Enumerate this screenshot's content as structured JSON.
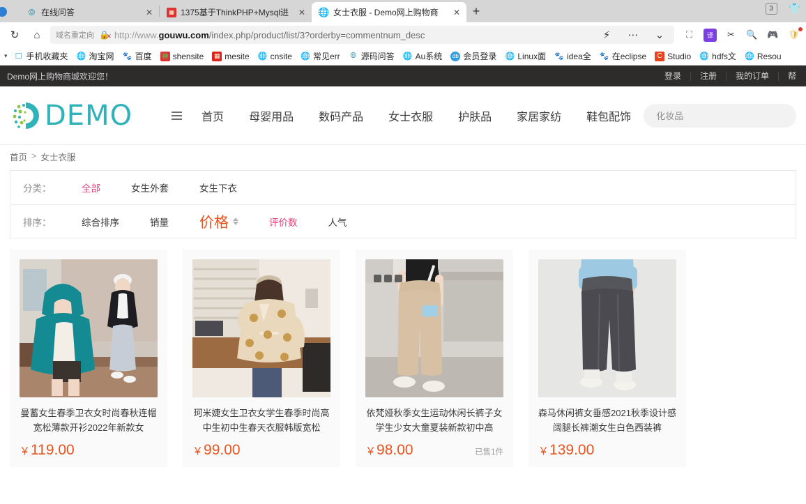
{
  "browser": {
    "tabs": [
      {
        "title": "在线问答",
        "favicon": "compass-icon",
        "active": false
      },
      {
        "title": "1375基于ThinkPHP+Mysql进",
        "favicon": "red-doc-icon",
        "active": false
      },
      {
        "title": "女士衣服 - Demo网上购物商",
        "favicon": "globe-icon",
        "active": true
      }
    ],
    "new_tab_label": "+",
    "tab_count": "3",
    "window_icon": "shirt-icon",
    "nav": {
      "reload_icon": "reload-icon",
      "home_icon": "home-icon",
      "redirect_tag": "域名重定向",
      "security_icon": "broken-lock-icon",
      "url_scheme": "http://www.",
      "url_domain": "gouwu.com",
      "url_path": "/index.php/product/list/3?orderby=commentnum_desc",
      "lightning_icon": "lightning-icon",
      "more_icon": "more-dots-icon",
      "chevron_icon": "chevron-down-icon",
      "extensions": [
        "pocket-icon",
        "translate-icon",
        "scissors-icon",
        "search-icon",
        "game-icon",
        "shield-icon"
      ]
    },
    "bookmarks": [
      {
        "label": "手机收藏夹",
        "icon": "mobile-icon"
      },
      {
        "label": "淘宝网",
        "icon": "globe-icon"
      },
      {
        "label": "百度",
        "icon": "baidu-icon"
      },
      {
        "label": "shensite",
        "icon": "shen-icon"
      },
      {
        "label": "mesite",
        "icon": "red-icon"
      },
      {
        "label": "cnsite",
        "icon": "globe-icon"
      },
      {
        "label": "常见err",
        "icon": "globe-icon"
      },
      {
        "label": "源码问答",
        "icon": "compass-icon"
      },
      {
        "label": "Au系统",
        "icon": "globe-icon"
      },
      {
        "label": "会员登录",
        "icon": "db-icon"
      },
      {
        "label": "Linux面",
        "icon": "globe-icon"
      },
      {
        "label": "idea全",
        "icon": "baidu-icon"
      },
      {
        "label": "在eclipse",
        "icon": "baidu-icon"
      },
      {
        "label": "Studio",
        "icon": "c-icon"
      },
      {
        "label": "hdfs文",
        "icon": "globe-icon"
      },
      {
        "label": "Resou",
        "icon": "globe-icon"
      }
    ]
  },
  "site": {
    "topbar": {
      "welcome": "Demo网上购物商城欢迎您！",
      "links": [
        "登录",
        "注册",
        "我的订单",
        "帮"
      ]
    },
    "header": {
      "logo_text": "DEMO",
      "logo_icon": "demo-circle-logo",
      "menu_icon": "hamburger-icon",
      "nav": [
        "首页",
        "母婴用品",
        "数码产品",
        "女士衣服",
        "护肤品",
        "家居家纺",
        "鞋包配饰"
      ],
      "search_placeholder": "化妆品"
    },
    "breadcrumb": {
      "home": "首页",
      "separator": ">",
      "current": "女士衣服"
    },
    "filters": {
      "category_label": "分类：",
      "categories": [
        {
          "label": "全部",
          "active": true
        },
        {
          "label": "女生外套",
          "active": false
        },
        {
          "label": "女生下衣",
          "active": false
        }
      ],
      "sort_label": "排序：",
      "sorts": [
        {
          "label": "综合排序",
          "active": false,
          "arrows": false
        },
        {
          "label": "销量",
          "active": false,
          "arrows": false
        },
        {
          "label": "价格",
          "active": false,
          "arrows": true
        },
        {
          "label": "评价数",
          "active": true,
          "arrows": false
        },
        {
          "label": "人气",
          "active": false,
          "arrows": false
        }
      ]
    },
    "products": [
      {
        "name": "曼蓄女生春季卫衣女时尚春秋连帽宽松薄款开衫2022年新款女",
        "currency": "￥",
        "price": "119.00",
        "sold": "",
        "image": "teal-hoodie-two-models"
      },
      {
        "name": "珂米婕女生卫衣女学生春季时尚高中生初中生春天衣服韩版宽松",
        "currency": "￥",
        "price": "99.00",
        "sold": "",
        "image": "beige-bear-hoodie"
      },
      {
        "name": "依梵娅秋季女生运动休闲长裤子女学生少女大童夏装新款初中高",
        "currency": "￥",
        "price": "98.00",
        "sold": "已售1件",
        "image": "beige-wide-leg-pants"
      },
      {
        "name": "森马休闲裤女垂感2021秋季设计感阔腿长裤潮女生白色西装裤",
        "currency": "￥",
        "price": "139.00",
        "sold": "",
        "image": "grey-wide-leg-pants"
      }
    ]
  },
  "colors": {
    "accent_teal": "#2fb3b9",
    "price_orange": "#e8541e",
    "active_pink": "#e4437a",
    "topbar_dark": "#2e2b2b"
  }
}
